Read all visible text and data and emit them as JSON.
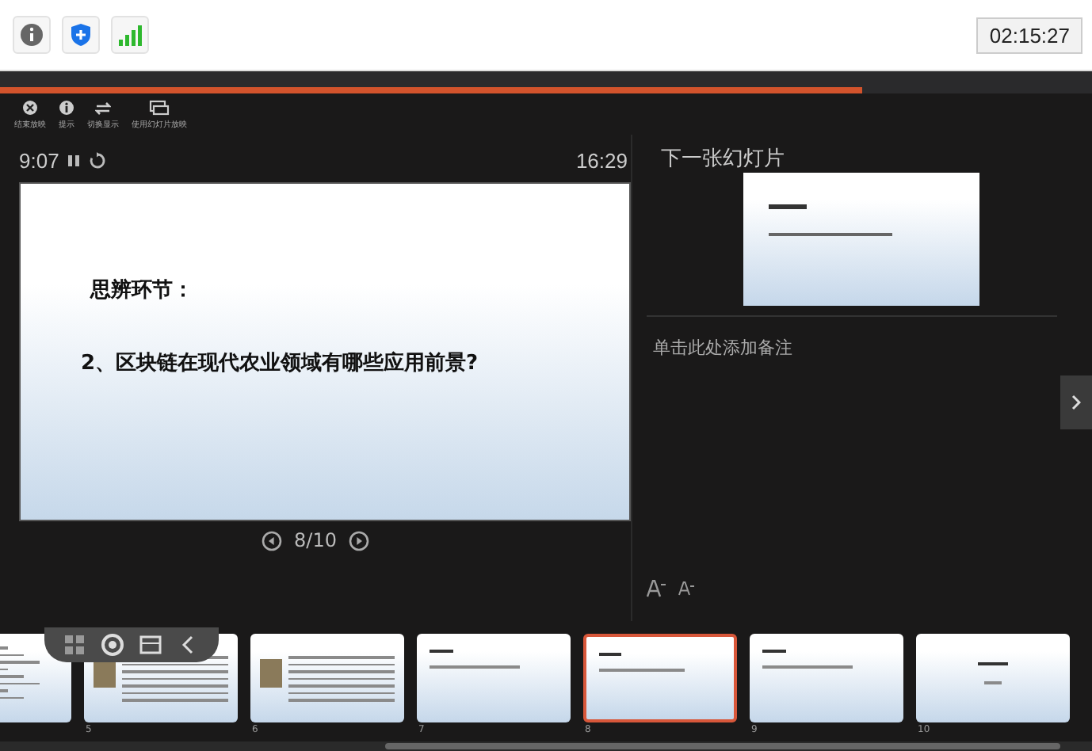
{
  "status_bar": {
    "clock": "02:15:27"
  },
  "progress": {
    "level": 0.79
  },
  "toolbar": [
    {
      "kind": "close",
      "label": "结束放映"
    },
    {
      "kind": "info",
      "label": "提示"
    },
    {
      "kind": "swap",
      "label": "切换显示"
    },
    {
      "kind": "window",
      "label": "使用幻灯片放映"
    }
  ],
  "timer": {
    "elapsed": "9:07",
    "clock": "16:29"
  },
  "current_slide": {
    "heading": "思辨环节：",
    "question": "2、区块链在现代农业领域有哪些应用前景?"
  },
  "navigation": {
    "counter": "8/10"
  },
  "next_slide": {
    "title": "下一张幻灯片"
  },
  "notes": {
    "placeholder": "单击此处添加备注"
  },
  "thumbnails": [
    {
      "kind": "text",
      "selected": false
    },
    {
      "kind": "photo",
      "number": "5",
      "selected": false
    },
    {
      "kind": "photo",
      "number": "6",
      "selected": false
    },
    {
      "kind": "question",
      "number": "7",
      "selected": false
    },
    {
      "kind": "question",
      "number": "8",
      "selected": true
    },
    {
      "kind": "question",
      "number": "9",
      "selected": false
    },
    {
      "kind": "title",
      "number": "10",
      "selected": false
    }
  ]
}
